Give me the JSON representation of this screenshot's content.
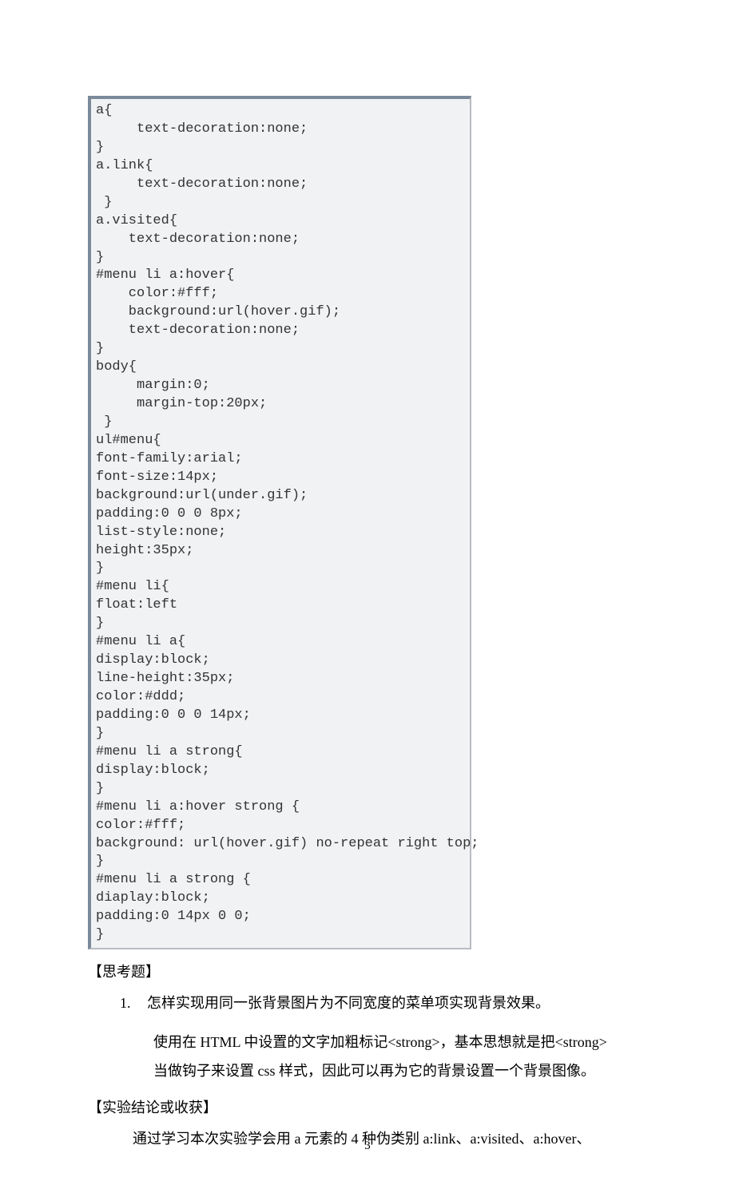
{
  "code": "a{\n     text-decoration:none;\n}\na.link{\n     text-decoration:none;\n }\na.visited{\n    text-decoration:none;\n}\n#menu li a:hover{\n    color:#fff;\n    background:url(hover.gif);\n    text-decoration:none;\n}\nbody{\n     margin:0;\n     margin-top:20px;\n }\nul#menu{\nfont-family:arial;\nfont-size:14px;\nbackground:url(under.gif);\npadding:0 0 0 8px;\nlist-style:none;\nheight:35px;\n}\n#menu li{\nfloat:left\n}\n#menu li a{\ndisplay:block;\nline-height:35px;\ncolor:#ddd;\npadding:0 0 0 14px;\n}\n#menu li a strong{\ndisplay:block;\n}\n#menu li a:hover strong {\ncolor:#fff;\nbackground: url(hover.gif) no-repeat right top;\n}\n#menu li a strong {\ndiaplay:block;\npadding:0 14px 0 0;\n}",
  "section_heading": "【思考题】",
  "question": {
    "number": "1.",
    "text": "怎样实现用同一张背景图片为不同宽度的菜单项实现背景效果。"
  },
  "answer_line1": "使用在 HTML 中设置的文字加粗标记<strong>，基本思想就是把<strong>",
  "answer_line2": "当做钩子来设置 css 样式，因此可以再为它的背景设置一个背景图像。",
  "conclusion_heading": "【实验结论或收获】",
  "conclusion_text": "通过学习本次实验学会用 a 元素的 4 种伪类别 a:link、a:visited、a:hover、",
  "page_number": "3"
}
